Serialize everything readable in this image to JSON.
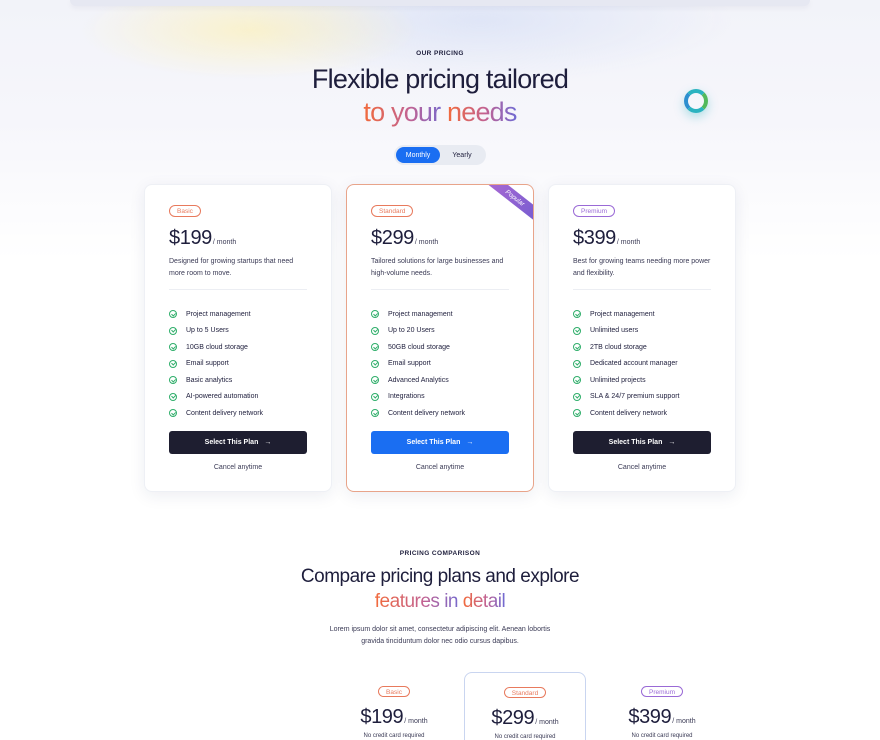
{
  "hero": {
    "eyebrow": "OUR PRICING",
    "title_line1": "Flexible pricing tailored",
    "title_line2_a": "to your ",
    "title_line2_b": "needs"
  },
  "billing_toggle": {
    "monthly": "Monthly",
    "yearly": "Yearly",
    "selected": "Monthly"
  },
  "colors": {
    "primary": "#1a6ef2",
    "dark_button": "#1e1e30",
    "check": "#2fae6a",
    "accent_orange": "#f26a3b",
    "accent_purple": "#6f6bd4"
  },
  "plans": [
    {
      "badge": "Basic",
      "badge_color": "#e87a5d",
      "price": "$199",
      "period": "/ month",
      "description": "Designed for growing startups that need more room to move.",
      "features": [
        "Project management",
        "Up to 5 Users",
        "10GB cloud storage",
        "Email support",
        "Basic analytics",
        "AI-powered automation",
        "Content delivery network"
      ],
      "cta": "Select This Plan",
      "cancel_note": "Cancel anytime"
    },
    {
      "badge": "Standard",
      "badge_color": "#e87a5d",
      "ribbon": "Popular",
      "price": "$299",
      "period": "/ month",
      "description": "Tailored solutions for large businesses and high-volume needs.",
      "features": [
        "Project management",
        "Up to 20 Users",
        "50GB cloud storage",
        "Email support",
        "Advanced Analytics",
        "Integrations",
        "Content delivery network"
      ],
      "cta": "Select This Plan",
      "cancel_note": "Cancel anytime"
    },
    {
      "badge": "Premium",
      "badge_color": "#9a6ad6",
      "price": "$399",
      "period": "/ month",
      "description": "Best for growing teams needing more power and flexibility.",
      "features": [
        "Project management",
        "Unlimited users",
        "2TB cloud storage",
        "Dedicated account manager",
        "Unlimited projects",
        "SLA & 24/7 premium support",
        "Content delivery network"
      ],
      "cta": "Select This Plan",
      "cancel_note": "Cancel anytime"
    }
  ],
  "comparison": {
    "eyebrow": "PRICING COMPARISON",
    "title_line1": "Compare pricing plans and explore",
    "title_line2_a": "features in ",
    "title_line2_b": "detail",
    "subtitle_line1": "Lorem ipsum dolor sit amet, consectetur adipiscing elit. Aenean lobortis",
    "subtitle_line2": "gravida tinciduntum dolor nec odio cursus dapibus.",
    "columns": [
      {
        "badge": "Basic",
        "price": "$199",
        "period": "/ month",
        "note": "No credit card required"
      },
      {
        "badge": "Standard",
        "price": "$299",
        "period": "/ month",
        "note": "No credit card required"
      },
      {
        "badge": "Premium",
        "price": "$399",
        "period": "/ month",
        "note": "No credit card required"
      }
    ]
  }
}
